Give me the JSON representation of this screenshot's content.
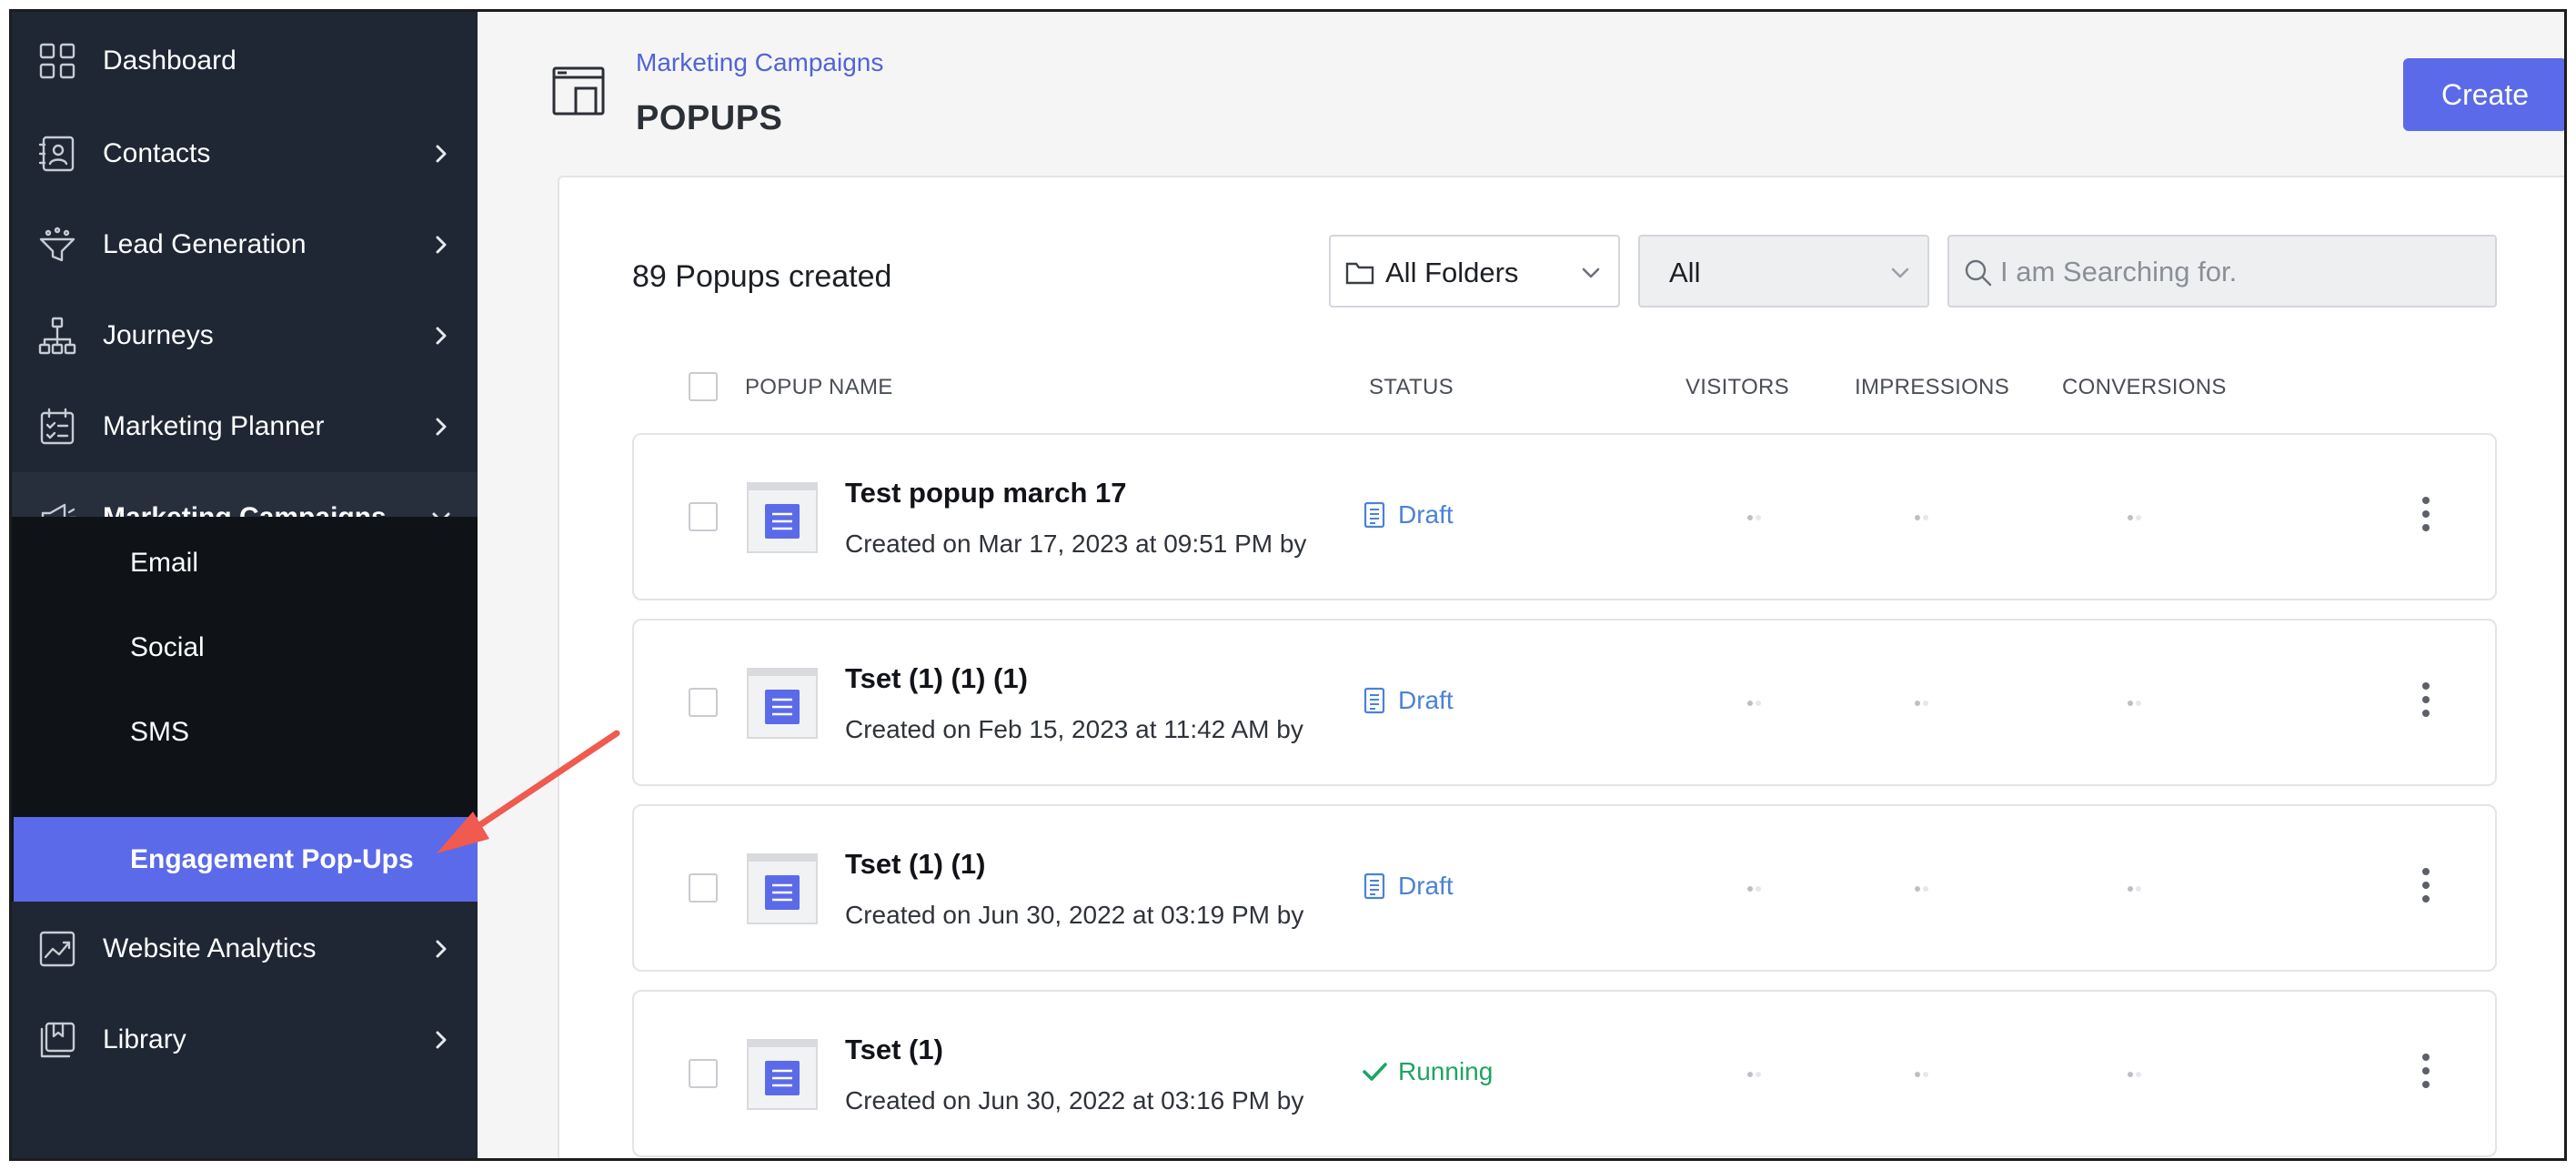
{
  "sidebar": {
    "items": [
      {
        "label": "Dashboard",
        "icon": "dashboard-grid-icon"
      },
      {
        "label": "Contacts",
        "icon": "contacts-icon"
      },
      {
        "label": "Lead Generation",
        "icon": "funnel-icon"
      },
      {
        "label": "Journeys",
        "icon": "hierarchy-icon"
      },
      {
        "label": "Marketing Planner",
        "icon": "planner-icon"
      },
      {
        "label": "Marketing Campaigns",
        "icon": "megaphone-icon"
      },
      {
        "label": "Website Analytics",
        "icon": "analytics-icon"
      },
      {
        "label": "Library",
        "icon": "library-icon"
      }
    ],
    "submenu": [
      {
        "label": "Email"
      },
      {
        "label": "Social"
      },
      {
        "label": "SMS"
      },
      {
        "label": "Engagement Pop-Ups"
      }
    ]
  },
  "header": {
    "breadcrumb": "Marketing Campaigns",
    "title": "POPUPS",
    "create_label": "Create"
  },
  "toolbar": {
    "count_label": "89 Popups created",
    "folder_select": "All Folders",
    "status_select": "All",
    "search_placeholder": "I am Searching for."
  },
  "table": {
    "columns": {
      "name": "POPUP NAME",
      "status": "STATUS",
      "visitors": "VISITORS",
      "impressions": "IMPRESSIONS",
      "conversions": "CONVERSIONS"
    },
    "rows": [
      {
        "name": "Test popup march 17",
        "created": "Created on Mar 17, 2023 at 09:51 PM by",
        "status": "Draft"
      },
      {
        "name": "Tset (1) (1) (1)",
        "created": "Created on Feb 15, 2023 at 11:42 AM by",
        "status": "Draft"
      },
      {
        "name": "Tset (1) (1)",
        "created": "Created on Jun 30, 2022 at 03:19 PM by",
        "status": "Draft"
      },
      {
        "name": "Tset (1)",
        "created": "Created on Jun 30, 2022 at 03:16 PM by",
        "status": "Running"
      }
    ]
  },
  "colors": {
    "sidebar_bg": "#1e2733",
    "submenu_bg": "#0f1318",
    "accent": "#5b6ae8",
    "draft": "#4a82d6",
    "running": "#1ea462",
    "annotation_arrow": "#f05a4f"
  }
}
